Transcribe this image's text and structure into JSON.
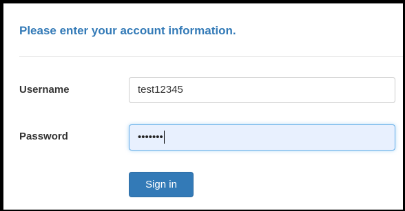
{
  "form": {
    "heading": "Please enter your account information.",
    "username": {
      "label": "Username",
      "value": "test12345"
    },
    "password": {
      "label": "Password",
      "masked_value": "•••••••"
    },
    "submit_label": "Sign in"
  },
  "colors": {
    "heading": "#337ab7",
    "button": "#337ab7",
    "focus_border": "#66afe9",
    "focused_field_bg": "#e8f0fe"
  }
}
